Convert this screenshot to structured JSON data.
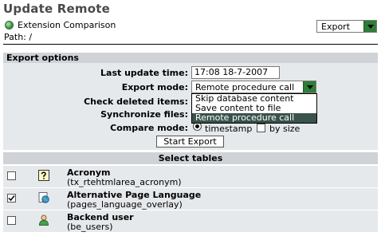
{
  "page_title": "Update Remote",
  "extension": {
    "label": "Extension Comparison",
    "icon": "globe-icon"
  },
  "path_label": "Path: /",
  "export_select": {
    "value": "Export"
  },
  "export_options": {
    "header": "Export options",
    "last_update_label": "Last update time:",
    "last_update_value": "17:08 18-7-2007",
    "export_mode_label": "Export mode:",
    "export_mode_value": "Remote procedure call",
    "export_mode_options": [
      "Skip database content",
      "Save content to file",
      "Remote procedure call"
    ],
    "check_deleted_label": "Check deleted items:",
    "sync_files_label": "Synchronize files:",
    "compare_mode_label": "Compare mode:",
    "compare_timestamp_label": "timestamp",
    "compare_size_label": "by size",
    "start_button": "Start Export"
  },
  "select_tables": {
    "header": "Select tables",
    "rows": [
      {
        "name": "Acronym",
        "table": "(tx_rtehtmlarea_acronym)",
        "checked": false,
        "icon": "acronym-icon"
      },
      {
        "name": "Alternative Page Language",
        "table": "(pages_language_overlay)",
        "checked": true,
        "icon": "page-language-icon"
      },
      {
        "name": "Backend user",
        "table": "(be_users)",
        "checked": false,
        "icon": "user-icon"
      }
    ]
  },
  "colors": {
    "accent_green": "#2f7d36",
    "band": "#cfd3d8",
    "panel": "#e6e9ec",
    "selected": "#39534b"
  }
}
